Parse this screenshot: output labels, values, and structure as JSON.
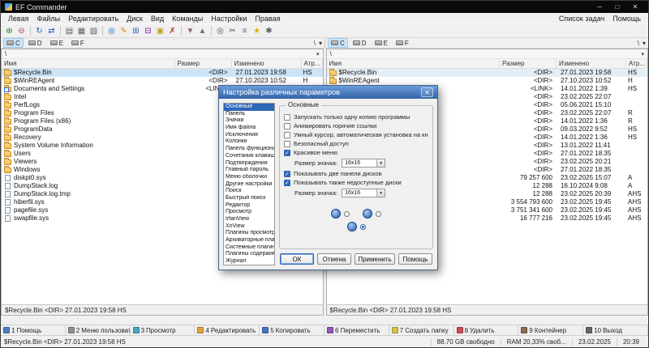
{
  "window": {
    "title": "EF Commander",
    "controls": {
      "minimize": "─",
      "maximize": "□",
      "close": "✕"
    }
  },
  "menu": {
    "items": [
      "Левая",
      "Файлы",
      "Редактировать",
      "Диск",
      "Вид",
      "Команды",
      "Настройки",
      "Правая"
    ],
    "right_items": [
      "Список задач",
      "Помощь"
    ]
  },
  "toolbar": {
    "icons": [
      {
        "name": "connect-network-drive-icon",
        "glyph": "⊕",
        "color": "#2e7d32"
      },
      {
        "name": "disconnect-network-drive-icon",
        "glyph": "⊖",
        "color": "#b23b3b"
      },
      {
        "type": "sep"
      },
      {
        "name": "refresh-icon",
        "glyph": "↻",
        "color": "#1565c0"
      },
      {
        "name": "swap-panels-icon",
        "glyph": "⇄",
        "color": "#1565c0"
      },
      {
        "type": "sep"
      },
      {
        "name": "brief-view-icon",
        "glyph": "▤",
        "color": "#616161"
      },
      {
        "name": "detailed-view-icon",
        "glyph": "▦",
        "color": "#616161"
      },
      {
        "name": "tree-view-icon",
        "glyph": "▧",
        "color": "#616161"
      },
      {
        "type": "sep"
      },
      {
        "name": "view-file-icon",
        "glyph": "◎",
        "color": "#1565c0"
      },
      {
        "name": "edit-file-icon",
        "glyph": "✎",
        "color": "#e68a00"
      },
      {
        "name": "copy-files-icon",
        "glyph": "⊞",
        "color": "#2e66b8"
      },
      {
        "name": "move-files-icon",
        "glyph": "⊟",
        "color": "#7b1fa2"
      },
      {
        "name": "new-folder-icon",
        "glyph": "▣",
        "color": "#c8a020"
      },
      {
        "name": "delete-files-icon",
        "glyph": "✗",
        "color": "#c62828"
      },
      {
        "type": "sep"
      },
      {
        "name": "pack-files-icon",
        "glyph": "▼",
        "color": "#8d6e63"
      },
      {
        "name": "unpack-files-icon",
        "glyph": "▲",
        "color": "#8d6e63"
      },
      {
        "type": "sep"
      },
      {
        "name": "search-icon",
        "glyph": "◎",
        "color": "#455a64"
      },
      {
        "name": "cut-icon",
        "glyph": "✂",
        "color": "#455a64"
      },
      {
        "name": "print-icon",
        "glyph": "≡",
        "color": "#616161"
      },
      {
        "name": "favorites-icon",
        "glyph": "★",
        "color": "#e6b400"
      },
      {
        "name": "settings-icon",
        "glyph": "✱",
        "color": "#616161"
      }
    ]
  },
  "drive_bars": {
    "left": {
      "drives": [
        "C",
        "D",
        "E",
        "F"
      ],
      "active": "C",
      "root_label": "\\",
      "dropdown_glyph": "▾"
    },
    "right": {
      "drives": [
        "C",
        "D",
        "E",
        "F"
      ],
      "active": "C",
      "root_label": "\\",
      "dropdown_glyph": "▾"
    }
  },
  "panels": {
    "left": {
      "path": "\\",
      "dropdown_glyph": "▾",
      "columns": [
        "Имя",
        "Размер",
        "Изменено",
        "Атр..."
      ],
      "footer": "$Recycle.Bin  <DIR>  27.01.2023 19:58  HS",
      "rows": [
        {
          "name": "$Recycle.Bin",
          "icon": "folder",
          "size": "<DIR>",
          "modified": "27.01.2023 19:58",
          "attr": "HS",
          "selected": true
        },
        {
          "name": "$WinREAgent",
          "icon": "folder",
          "size": "<DIR>",
          "modified": "27.10.2023 10:52",
          "attr": "H"
        },
        {
          "name": "Documents and Settings",
          "icon": "link",
          "size": "<LINK>",
          "modified": "14.01.2022 1:39",
          "attr": "HS"
        },
        {
          "name": "Intel",
          "icon": "folder",
          "size": "",
          "modified": "",
          "attr": ""
        },
        {
          "name": "PerfLogs",
          "icon": "folder",
          "size": "",
          "modified": "",
          "attr": ""
        },
        {
          "name": "Program Files",
          "icon": "folder",
          "size": "",
          "modified": "",
          "attr": ""
        },
        {
          "name": "Program Files (x86)",
          "icon": "folder",
          "size": "",
          "modified": "",
          "attr": ""
        },
        {
          "name": "ProgramData",
          "icon": "folder",
          "size": "",
          "modified": "",
          "attr": ""
        },
        {
          "name": "Recovery",
          "icon": "folder",
          "size": "",
          "modified": "",
          "attr": ""
        },
        {
          "name": "System Volume Information",
          "icon": "folder",
          "size": "",
          "modified": "",
          "attr": ""
        },
        {
          "name": "Users",
          "icon": "folder",
          "size": "",
          "modified": "",
          "attr": ""
        },
        {
          "name": "Viewers",
          "icon": "folder",
          "size": "",
          "modified": "",
          "attr": ""
        },
        {
          "name": "Windows",
          "icon": "folder",
          "size": "",
          "modified": "",
          "attr": ""
        },
        {
          "name": "diskpt0.sys",
          "icon": "file",
          "size": "",
          "modified": "",
          "attr": ""
        },
        {
          "name": "DumpStack.log",
          "icon": "file",
          "size": "",
          "modified": "",
          "attr": ""
        },
        {
          "name": "DumpStack.log.tmp",
          "icon": "file",
          "size": "",
          "modified": "",
          "attr": ""
        },
        {
          "name": "hiberfil.sys",
          "icon": "file",
          "size": "",
          "modified": "",
          "attr": ""
        },
        {
          "name": "pagefile.sys",
          "icon": "file",
          "size": "",
          "modified": "",
          "attr": ""
        },
        {
          "name": "swapfile.sys",
          "icon": "file",
          "size": "",
          "modified": "",
          "attr": ""
        }
      ]
    },
    "right": {
      "path": "\\",
      "dropdown_glyph": "▾",
      "columns": [
        "Имя",
        "Размер",
        "Изменено",
        "Атр..."
      ],
      "footer": "$Recycle.Bin  <DIR>  27.01.2023 19:58  HS",
      "rows": [
        {
          "name": "$Recycle.Bin",
          "icon": "folder",
          "size": "<DIR>",
          "modified": "27.01.2023 19:58",
          "attr": "HS",
          "selected": true
        },
        {
          "name": "$WinREAgent",
          "icon": "folder",
          "size": "<DIR>",
          "modified": "27.10.2023 10:52",
          "attr": "H"
        },
        {
          "name": "Documents and Settings",
          "icon": "link",
          "size": "<LINK>",
          "modified": "14.01.2022 1:39",
          "attr": "HS"
        },
        {
          "name": "",
          "icon": null,
          "size": "<DIR>",
          "modified": "23.02.2025 22:07",
          "attr": ""
        },
        {
          "name": "",
          "icon": null,
          "size": "<DIR>",
          "modified": "05.06.2021 15:10",
          "attr": ""
        },
        {
          "name": "",
          "icon": null,
          "size": "<DIR>",
          "modified": "23.02.2025 22:07",
          "attr": "R"
        },
        {
          "name": "",
          "icon": null,
          "size": "<DIR>",
          "modified": "14.01.2022 1:36",
          "attr": "R"
        },
        {
          "name": "",
          "icon": null,
          "size": "<DIR>",
          "modified": "09.03.2022 9:52",
          "attr": "HS"
        },
        {
          "name": "",
          "icon": null,
          "size": "<DIR>",
          "modified": "14.01.2022 1:36",
          "attr": "HS"
        },
        {
          "name": "",
          "icon": null,
          "size": "<DIR>",
          "modified": "13.01.2022 11:41",
          "attr": ""
        },
        {
          "name": "",
          "icon": null,
          "size": "<DIR>",
          "modified": "27.01.2022 18:35",
          "attr": ""
        },
        {
          "name": "",
          "icon": null,
          "size": "<DIR>",
          "modified": "23.02.2025 20:21",
          "attr": ""
        },
        {
          "name": "",
          "icon": null,
          "size": "<DIR>",
          "modified": "27.01.2022 18:35",
          "attr": ""
        },
        {
          "name": "",
          "icon": null,
          "size": "79 257 600",
          "modified": "23.02.2025 15:07",
          "attr": "A"
        },
        {
          "name": "",
          "icon": null,
          "size": "12 288",
          "modified": "16.10.2024 9:08",
          "attr": "A"
        },
        {
          "name": "",
          "icon": null,
          "size": "12 288",
          "modified": "23.02.2025 20:39",
          "attr": "AHS"
        },
        {
          "name": "",
          "icon": null,
          "size": "3 554 793 600",
          "modified": "23.02.2025 19:45",
          "attr": "AHS"
        },
        {
          "name": "",
          "icon": null,
          "size": "3 751 341 600",
          "modified": "23.02.2025 19:45",
          "attr": "AHS"
        },
        {
          "name": "",
          "icon": null,
          "size": "16 777 216",
          "modified": "23.02.2025 19:45",
          "attr": "AHS"
        }
      ]
    }
  },
  "dialog": {
    "title": "Настройка различных параметров",
    "close_glyph": "✕",
    "check_glyph": "✓",
    "combo_glyph": "▼",
    "tree": [
      "Основные",
      "Панель",
      "Значки",
      "Имя файла",
      "Исключения",
      "Колонки",
      "Панель функциональн...",
      "Сочетания клавиш",
      "Подтверждения",
      "Главный пароль",
      "Меню оболочки",
      "Другие настройки",
      "Поиск",
      "Быстрый поиск",
      "Редактор",
      "Просмотр",
      "IrfanView",
      "XnView",
      "Плагины просмотра",
      "Архиваторные плагины",
      "Системные плагины",
      "Плагины содержимого",
      "Журнал"
    ],
    "selected_tree_item": "Основные",
    "group_title": "Основные",
    "options": [
      {
        "type": "check",
        "label": "Запускать только одну копию программы",
        "checked": false
      },
      {
        "type": "check",
        "label": "Анимировать горячие ссылки",
        "checked": false
      },
      {
        "type": "check",
        "label": "Умный курсор, автоматическая установка на кнопку",
        "checked": false
      },
      {
        "type": "check",
        "label": "Безопасный доступ",
        "checked": false
      },
      {
        "type": "check",
        "label": "Красивое меню",
        "checked": true
      },
      {
        "type": "size",
        "label": "Размер значка:",
        "value": "16x16"
      },
      {
        "type": "check",
        "label": "Показывать две панели дисков",
        "checked": true
      },
      {
        "type": "check",
        "label": "Показывать также недоступные диски",
        "checked": true
      },
      {
        "type": "size",
        "label": "Размер значка:",
        "value": "16x16"
      }
    ],
    "icon_options": [
      {
        "selected": false
      },
      {
        "selected": false
      },
      {
        "selected": true
      }
    ],
    "buttons": [
      {
        "name": "ok-button",
        "label": "ОК"
      },
      {
        "name": "cancel-button",
        "label": "Отмена"
      },
      {
        "name": "apply-button",
        "label": "Применить"
      },
      {
        "name": "help-button",
        "label": "Помощь"
      }
    ]
  },
  "function_bar": [
    {
      "key": "1",
      "label": "Помощь",
      "color": "#4b7fc4"
    },
    {
      "key": "2",
      "label": "Меню пользователя",
      "color": "#8f8f8f"
    },
    {
      "key": "3",
      "label": "Просмотр",
      "color": "#4ba3c4"
    },
    {
      "key": "4",
      "label": "Редактировать",
      "color": "#e0a23b"
    },
    {
      "key": "5",
      "label": "Копировать",
      "color": "#4b6fc4"
    },
    {
      "key": "6",
      "label": "Переместить",
      "color": "#9455b8"
    },
    {
      "key": "7",
      "label": "Создать папку",
      "color": "#d9c14b"
    },
    {
      "key": "8",
      "label": "Удалить",
      "color": "#cc4b4b"
    },
    {
      "key": "9",
      "label": "Контейнер",
      "color": "#8a6d4b"
    },
    {
      "key": "10",
      "label": "Выход",
      "color": "#666666"
    }
  ],
  "status_bar": {
    "selection_info": "$Recycle.Bin  <DIR>  27.01.2023 19:58  HS",
    "cells": [
      "88.70 GB свободно",
      "RAM 20,33% своб...",
      "23.02.2025",
      "20:39"
    ]
  }
}
